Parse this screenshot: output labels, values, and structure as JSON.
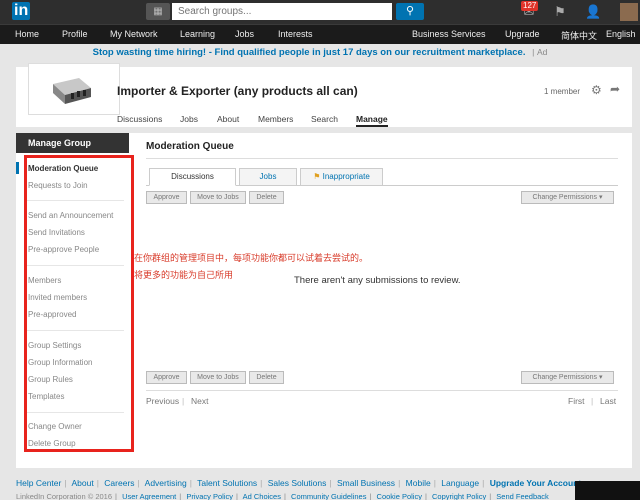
{
  "topbar": {
    "logo": "in",
    "search_placeholder": "Search groups...",
    "search_icon": "search-icon",
    "notification_count": "127"
  },
  "nav": {
    "items": [
      "Home",
      "Profile",
      "My Network",
      "Learning",
      "Jobs",
      "Interests"
    ],
    "right_items": [
      "Business Services",
      "Upgrade",
      "简体中文",
      "English"
    ]
  },
  "ad": {
    "text": "Stop wasting time hiring! - Find qualified people in just 17 days on our recruitment marketplace.",
    "label": "Ad"
  },
  "group": {
    "title": "Importer & Exporter (any products all can)",
    "member_count": "1 member",
    "tabs": [
      "Discussions",
      "Jobs",
      "About",
      "Members",
      "Search",
      "Manage"
    ],
    "active_tab": "Manage"
  },
  "sidebar": {
    "heading": "Manage Group",
    "items": [
      "Moderation Queue",
      "Requests to Join",
      "Send an Announcement",
      "Send Invitations",
      "Pre-approve People",
      "Members",
      "Invited members",
      "Pre-approved",
      "Group Settings",
      "Group Information",
      "Group Rules",
      "Templates",
      "Change Owner",
      "Delete Group"
    ]
  },
  "queue": {
    "title": "Moderation Queue",
    "tabs": [
      "Discussions",
      "Jobs",
      "Inappropriate"
    ],
    "buttons": {
      "approve": "Approve",
      "move_to_jobs": "Move to Jobs",
      "delete": "Delete",
      "change_permissions": "Change Permissions ▾"
    },
    "empty_message": "There aren't any submissions to review.",
    "pager": {
      "previous": "Previous",
      "next": "Next",
      "first": "First",
      "last": "Last"
    }
  },
  "annotation": {
    "line1": "在你群组的管理项目中，每项功能你都可以试着去尝试的。",
    "line2": "将更多的功能为自己所用"
  },
  "footer": {
    "links": [
      "Help Center",
      "About",
      "Careers",
      "Advertising",
      "Talent Solutions",
      "Sales Solutions",
      "Small Business",
      "Mobile",
      "Language"
    ],
    "upgrade": "Upgrade Your Account",
    "copyright": "LinkedIn Corporation © 2016",
    "legal_links": [
      "User Agreement",
      "Privacy Policy",
      "Ad Choices",
      "Community Guidelines",
      "Cookie Policy",
      "Copyright Policy",
      "Send Feedback"
    ]
  },
  "colors": {
    "brand": "#0073b1",
    "annotation": "#e8231d"
  }
}
